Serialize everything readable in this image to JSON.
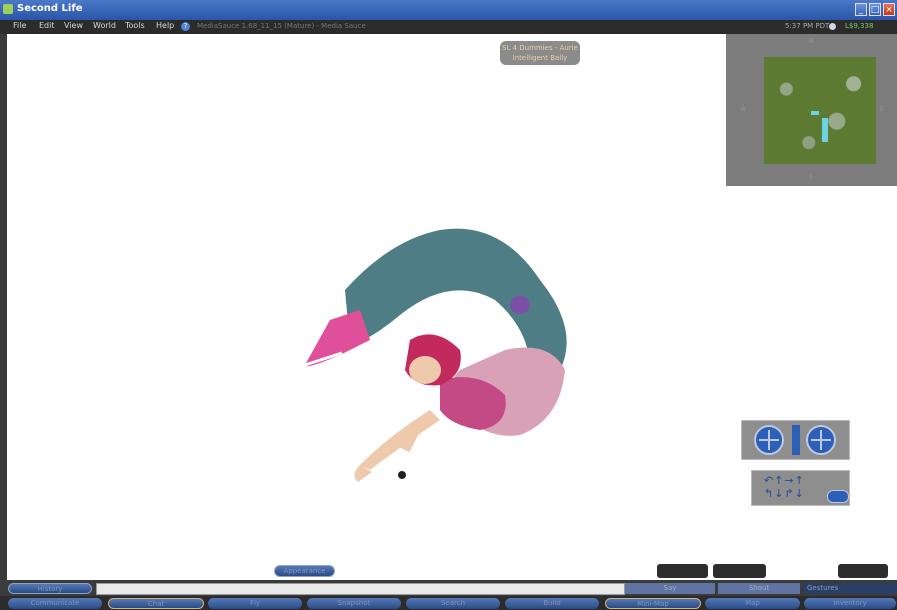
{
  "window": {
    "title": "Second Life"
  },
  "menu": [
    "File",
    "Edit",
    "View",
    "World",
    "Tools",
    "Help"
  ],
  "build_info": "MediaSauce 1.68_11_15 (Mature) - Media Sauce",
  "status": {
    "clock": "5:37 PM PDT",
    "balance": "L$9,338"
  },
  "location_badge": {
    "line1": "SL 4 Dummies - Aurie",
    "line2": "Intelligent Bally"
  },
  "minimap": {
    "n": "N",
    "s": "S",
    "e": "E",
    "w": "W"
  },
  "view_pill": "Appearance",
  "chat": {
    "history_label": "History",
    "say_label": "Say",
    "shout_label": "Shout",
    "gestures_label": "Gestures"
  },
  "buttons": [
    "Communicate",
    "Chat",
    "Fly",
    "Snapshot",
    "Search",
    "Build",
    "Mini-Map",
    "Map",
    "Inventory"
  ],
  "active_button": "Mini-Map",
  "colors": {
    "titlebar": "#2a55a8",
    "accent_blue": "#2c5fb7",
    "balance_green": "#7ccf6a",
    "badge_text": "#e7d1a6"
  }
}
